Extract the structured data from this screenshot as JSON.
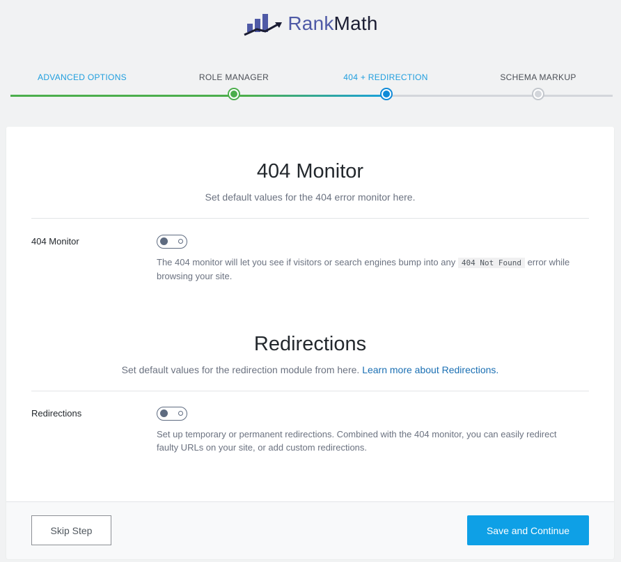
{
  "brand": {
    "rank": "Rank",
    "math": "Math"
  },
  "steps": [
    {
      "label": "ADVANCED OPTIONS",
      "state": "done"
    },
    {
      "label": "ROLE MANAGER",
      "state": "done"
    },
    {
      "label": "404 + REDIRECTION",
      "state": "active"
    },
    {
      "label": "SCHEMA MARKUP",
      "state": "pending"
    }
  ],
  "monitor": {
    "title": "404 Monitor",
    "desc": "Set default values for the 404 error monitor here.",
    "field_label": "404 Monitor",
    "toggle_on": false,
    "help_before": "The 404 monitor will let you see if visitors or search engines bump into any",
    "help_code": "404 Not Found",
    "help_after": "error while browsing your site."
  },
  "redirections": {
    "title": "Redirections",
    "desc": "Set default values for the redirection module from here.",
    "link": "Learn more about Redirections.",
    "field_label": "Redirections",
    "toggle_on": false,
    "help": "Set up temporary or permanent redirections. Combined with the 404 monitor, you can easily redirect faulty URLs on your site, or add custom redirections."
  },
  "footer": {
    "skip_label": "Skip Step",
    "save_label": "Save and Continue"
  },
  "colors": {
    "green": "#4cae4c",
    "blue": "#0f8ad8",
    "accent": "#0ea0e6",
    "brand": "#4f5aa6"
  }
}
